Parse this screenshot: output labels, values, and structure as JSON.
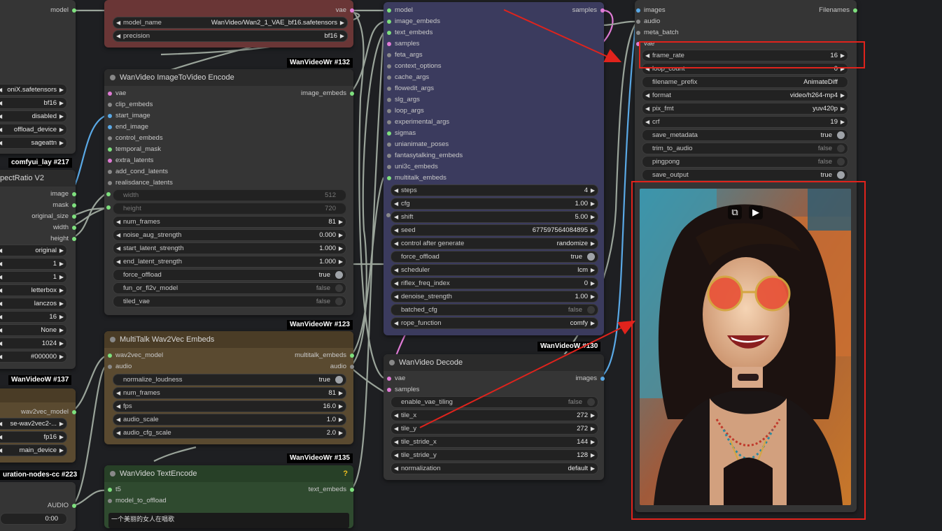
{
  "colors": {
    "wire_gray": "#9aa49a",
    "wire_blue": "#5aa9e6",
    "wire_pink": "#e07bd6",
    "red_annotation": "#e0231c",
    "pin_green": "#7ee07e",
    "pin_blue": "#5aa9e6",
    "pin_pink": "#e07bd6",
    "pin_gray": "#8a8a8a"
  },
  "left_partial": {
    "model_out": "model",
    "widgets": [
      "oniX.safetensors",
      "bf16",
      "disabled",
      "offload_device",
      "sageattn"
    ],
    "badge1": {
      "name": "comfyui_lay",
      "id": "#217"
    },
    "aspect_title": "pectRatio V2",
    "aspect_outputs": [
      "image",
      "mask",
      "original_size",
      "width",
      "height"
    ],
    "aspect_widgets": [
      "original",
      "1",
      "1",
      "letterbox",
      "lanczos",
      "16",
      "None",
      "1024",
      "#000000"
    ],
    "badge2": {
      "name": "WanVideoW",
      "id": "#137"
    },
    "w2v_out": "wav2vec_model",
    "w2v_widgets": [
      "se-wav2vec2-...",
      "fp16",
      "main_device"
    ],
    "badge3": {
      "name": "uration-nodes-cc",
      "id": "#223"
    },
    "audio_out": "AUDIO",
    "audio_widget": "0:00"
  },
  "vae_loader": {
    "out": "vae",
    "widgets": [
      {
        "label": "model_name",
        "value": "WanVideo/Wan2_1_VAE_bf16.safetensors"
      },
      {
        "label": "precision",
        "value": "bf16"
      }
    ],
    "badge": {
      "name": "WanVideoWr",
      "id": "#132"
    }
  },
  "i2v": {
    "title": "WanVideo ImageToVideo Encode",
    "inputs": [
      "vae",
      "clip_embeds",
      "start_image",
      "end_image",
      "control_embeds",
      "temporal_mask",
      "extra_latents",
      "add_cond_latents",
      "realisdance_latents"
    ],
    "output": "image_embeds",
    "dim_widgets": [
      {
        "label": "width",
        "value": "512"
      },
      {
        "label": "height",
        "value": "720"
      }
    ],
    "widgets": [
      {
        "label": "num_frames",
        "value": "81"
      },
      {
        "label": "noise_aug_strength",
        "value": "0.000"
      },
      {
        "label": "start_latent_strength",
        "value": "1.000"
      },
      {
        "label": "end_latent_strength",
        "value": "1.000"
      }
    ],
    "toggles": [
      {
        "label": "force_offload",
        "value": "true"
      },
      {
        "label": "fun_or_fl2v_model",
        "value": "false"
      },
      {
        "label": "tiled_vae",
        "value": "false"
      }
    ],
    "badge": {
      "name": "WanVideoWr",
      "id": "#123"
    }
  },
  "multitalk": {
    "title": "MultiTalk Wav2Vec Embeds",
    "inputs": [
      "wav2vec_model",
      "audio"
    ],
    "outputs": [
      "multitalk_embeds",
      "audio"
    ],
    "widgets": [
      {
        "label": "normalize_loudness",
        "value": "true",
        "toggle": true
      },
      {
        "label": "num_frames",
        "value": "81"
      },
      {
        "label": "fps",
        "value": "16.0"
      },
      {
        "label": "audio_scale",
        "value": "1.0"
      },
      {
        "label": "audio_cfg_scale",
        "value": "2.0"
      }
    ],
    "badge": {
      "name": "WanVideoWr",
      "id": "#135"
    }
  },
  "textencode": {
    "title": "WanVideo TextEncode",
    "help": "?",
    "inputs": [
      "t5",
      "model_to_offload"
    ],
    "output": "text_embeds",
    "prompt": "一个美丽的女人在唱歌"
  },
  "sampler": {
    "inputs": [
      "model",
      "image_embeds",
      "text_embeds",
      "samples",
      "feta_args",
      "context_options",
      "cache_args",
      "flowedit_args",
      "slg_args",
      "loop_args",
      "experimental_args",
      "sigmas",
      "unianimate_poses",
      "fantasytalking_embeds",
      "uni3c_embeds",
      "multitalk_embeds"
    ],
    "output": "samples",
    "widgets": [
      {
        "label": "steps",
        "value": "4"
      },
      {
        "label": "cfg",
        "value": "1.00"
      },
      {
        "label": "shift",
        "value": "5.00"
      },
      {
        "label": "seed",
        "value": "677597564084895"
      },
      {
        "label": "control after generate",
        "value": "randomize"
      },
      {
        "label": "force_offload",
        "value": "true",
        "toggle": true
      },
      {
        "label": "scheduler",
        "value": "lcm"
      },
      {
        "label": "riflex_freq_index",
        "value": "0"
      },
      {
        "label": "denoise_strength",
        "value": "1.00"
      },
      {
        "label": "batched_cfg",
        "value": "false",
        "toggle": true,
        "off": true
      },
      {
        "label": "rope_function",
        "value": "comfy"
      }
    ],
    "badge": {
      "name": "WanVideoW",
      "id": "#130"
    }
  },
  "decode": {
    "title": "WanVideo Decode",
    "inputs": [
      "vae",
      "samples"
    ],
    "output": "images",
    "widgets": [
      {
        "label": "enable_vae_tiling",
        "value": "false",
        "toggle": true,
        "off": true
      },
      {
        "label": "tile_x",
        "value": "272"
      },
      {
        "label": "tile_y",
        "value": "272"
      },
      {
        "label": "tile_stride_x",
        "value": "144"
      },
      {
        "label": "tile_stride_y",
        "value": "128"
      },
      {
        "label": "normalization",
        "value": "default"
      }
    ]
  },
  "combine": {
    "inputs": [
      "images",
      "audio",
      "meta_batch",
      "vae"
    ],
    "output": "Filenames",
    "widgets": [
      {
        "label": "frame_rate",
        "value": "16"
      },
      {
        "label": "loop_count",
        "value": "0"
      },
      {
        "label": "filename_prefix",
        "value": "AnimateDiff",
        "plain": true
      },
      {
        "label": "format",
        "value": "video/h264-mp4"
      },
      {
        "label": "pix_fmt",
        "value": "yuv420p"
      },
      {
        "label": "crf",
        "value": "19"
      },
      {
        "label": "save_metadata",
        "value": "true",
        "toggle": true
      },
      {
        "label": "trim_to_audio",
        "value": "false",
        "toggle": true,
        "off": true
      },
      {
        "label": "pingpong",
        "value": "false",
        "toggle": true,
        "off": true
      },
      {
        "label": "save_output",
        "value": "true",
        "toggle": true
      }
    ],
    "preview_icons": [
      "pip-icon",
      "play-sparkle-icon"
    ]
  }
}
